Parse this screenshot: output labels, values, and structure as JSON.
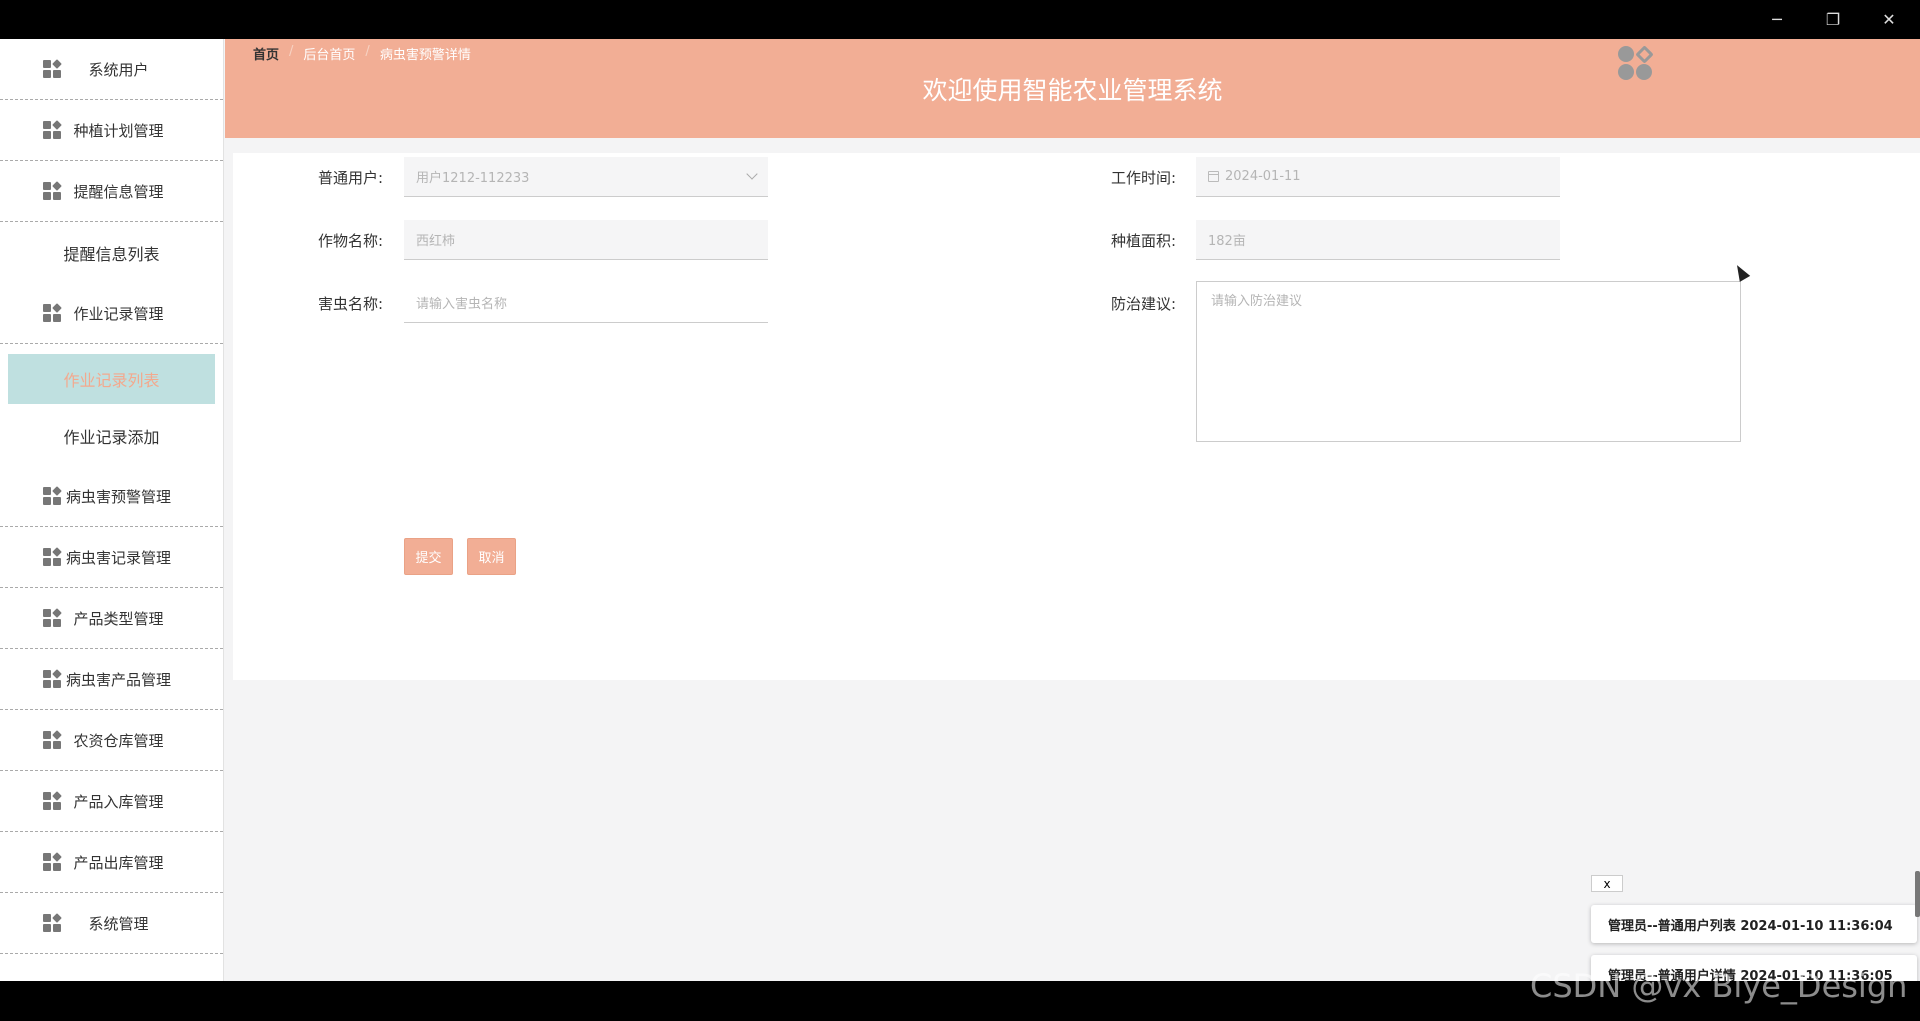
{
  "window": {
    "minimize": "─",
    "maximize": "❐",
    "close": "✕"
  },
  "sidebar": {
    "items": [
      {
        "label": "系统用户"
      },
      {
        "label": "种植计划管理"
      },
      {
        "label": "提醒信息管理"
      },
      {
        "label": "提醒信息列表",
        "sub": true
      },
      {
        "label": "作业记录管理"
      },
      {
        "label": "作业记录列表",
        "sub": true,
        "active": true
      },
      {
        "label": "作业记录添加",
        "sub": true
      },
      {
        "label": "病虫害预警管理"
      },
      {
        "label": "病虫害记录管理"
      },
      {
        "label": "产品类型管理"
      },
      {
        "label": "病虫害产品管理"
      },
      {
        "label": "农资仓库管理"
      },
      {
        "label": "产品入库管理"
      },
      {
        "label": "产品出库管理"
      },
      {
        "label": "系统管理"
      }
    ]
  },
  "header": {
    "breadcrumb": [
      "首页",
      "后台首页",
      "病虫害预警详情"
    ],
    "separator": "/",
    "title": "欢迎使用智能农业管理系统"
  },
  "form": {
    "user_label": "普通用户:",
    "user_value": "用户1212-112233",
    "work_time_label": "工作时间:",
    "work_time_value": "2024-01-11",
    "crop_label": "作物名称:",
    "crop_value": "西红柿",
    "area_label": "种植面积:",
    "area_value": "182亩",
    "pest_label": "害虫名称:",
    "pest_placeholder": "请输入害虫名称",
    "advice_label": "防治建议:",
    "advice_placeholder": "请输入防治建议",
    "submit_label": "提交",
    "cancel_label": "取消"
  },
  "notifications": {
    "close_label": "x",
    "items": [
      "管理员--普通用户列表 2024-01-10 11:36:04",
      "管理员--普通用户详情 2024-01-10 11:36:05"
    ]
  },
  "watermark": "CSDN @vx Biye_Design"
}
